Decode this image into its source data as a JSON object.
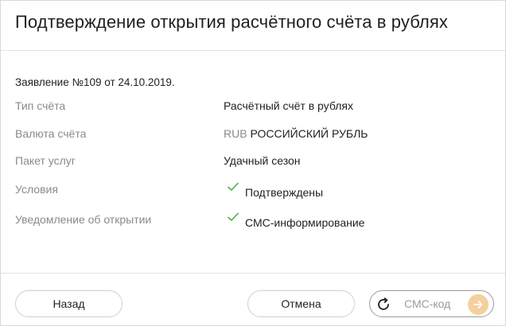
{
  "dialog": {
    "title": "Подтверждение открытия расчётного счёта в рублях",
    "statement": "Заявление №109 от 24.10.2019."
  },
  "details": {
    "account_type_label": "Тип счёта",
    "account_type_value": "Расчётный счёт в рублях",
    "currency_label": "Валюта счёта",
    "currency_code": "RUB",
    "currency_name": "РОССИЙСКИЙ РУБЛЬ",
    "package_label": "Пакет услуг",
    "package_value": "Удачный сезон",
    "conditions_label": "Условия",
    "conditions_value": "Подтверждены",
    "notification_label": "Уведомление об открытии",
    "notification_value": "СМС-информирование"
  },
  "footer": {
    "back_label": "Назад",
    "cancel_label": "Отмена",
    "sms_placeholder": "СМС-код"
  },
  "icons": {
    "check": "check-icon",
    "refresh": "refresh-icon",
    "submit_arrow": "arrow-right-icon"
  },
  "colors": {
    "check_green": "#4caf50",
    "submit_orange": "#f6cf9f",
    "muted_text": "#8a8a8a"
  }
}
